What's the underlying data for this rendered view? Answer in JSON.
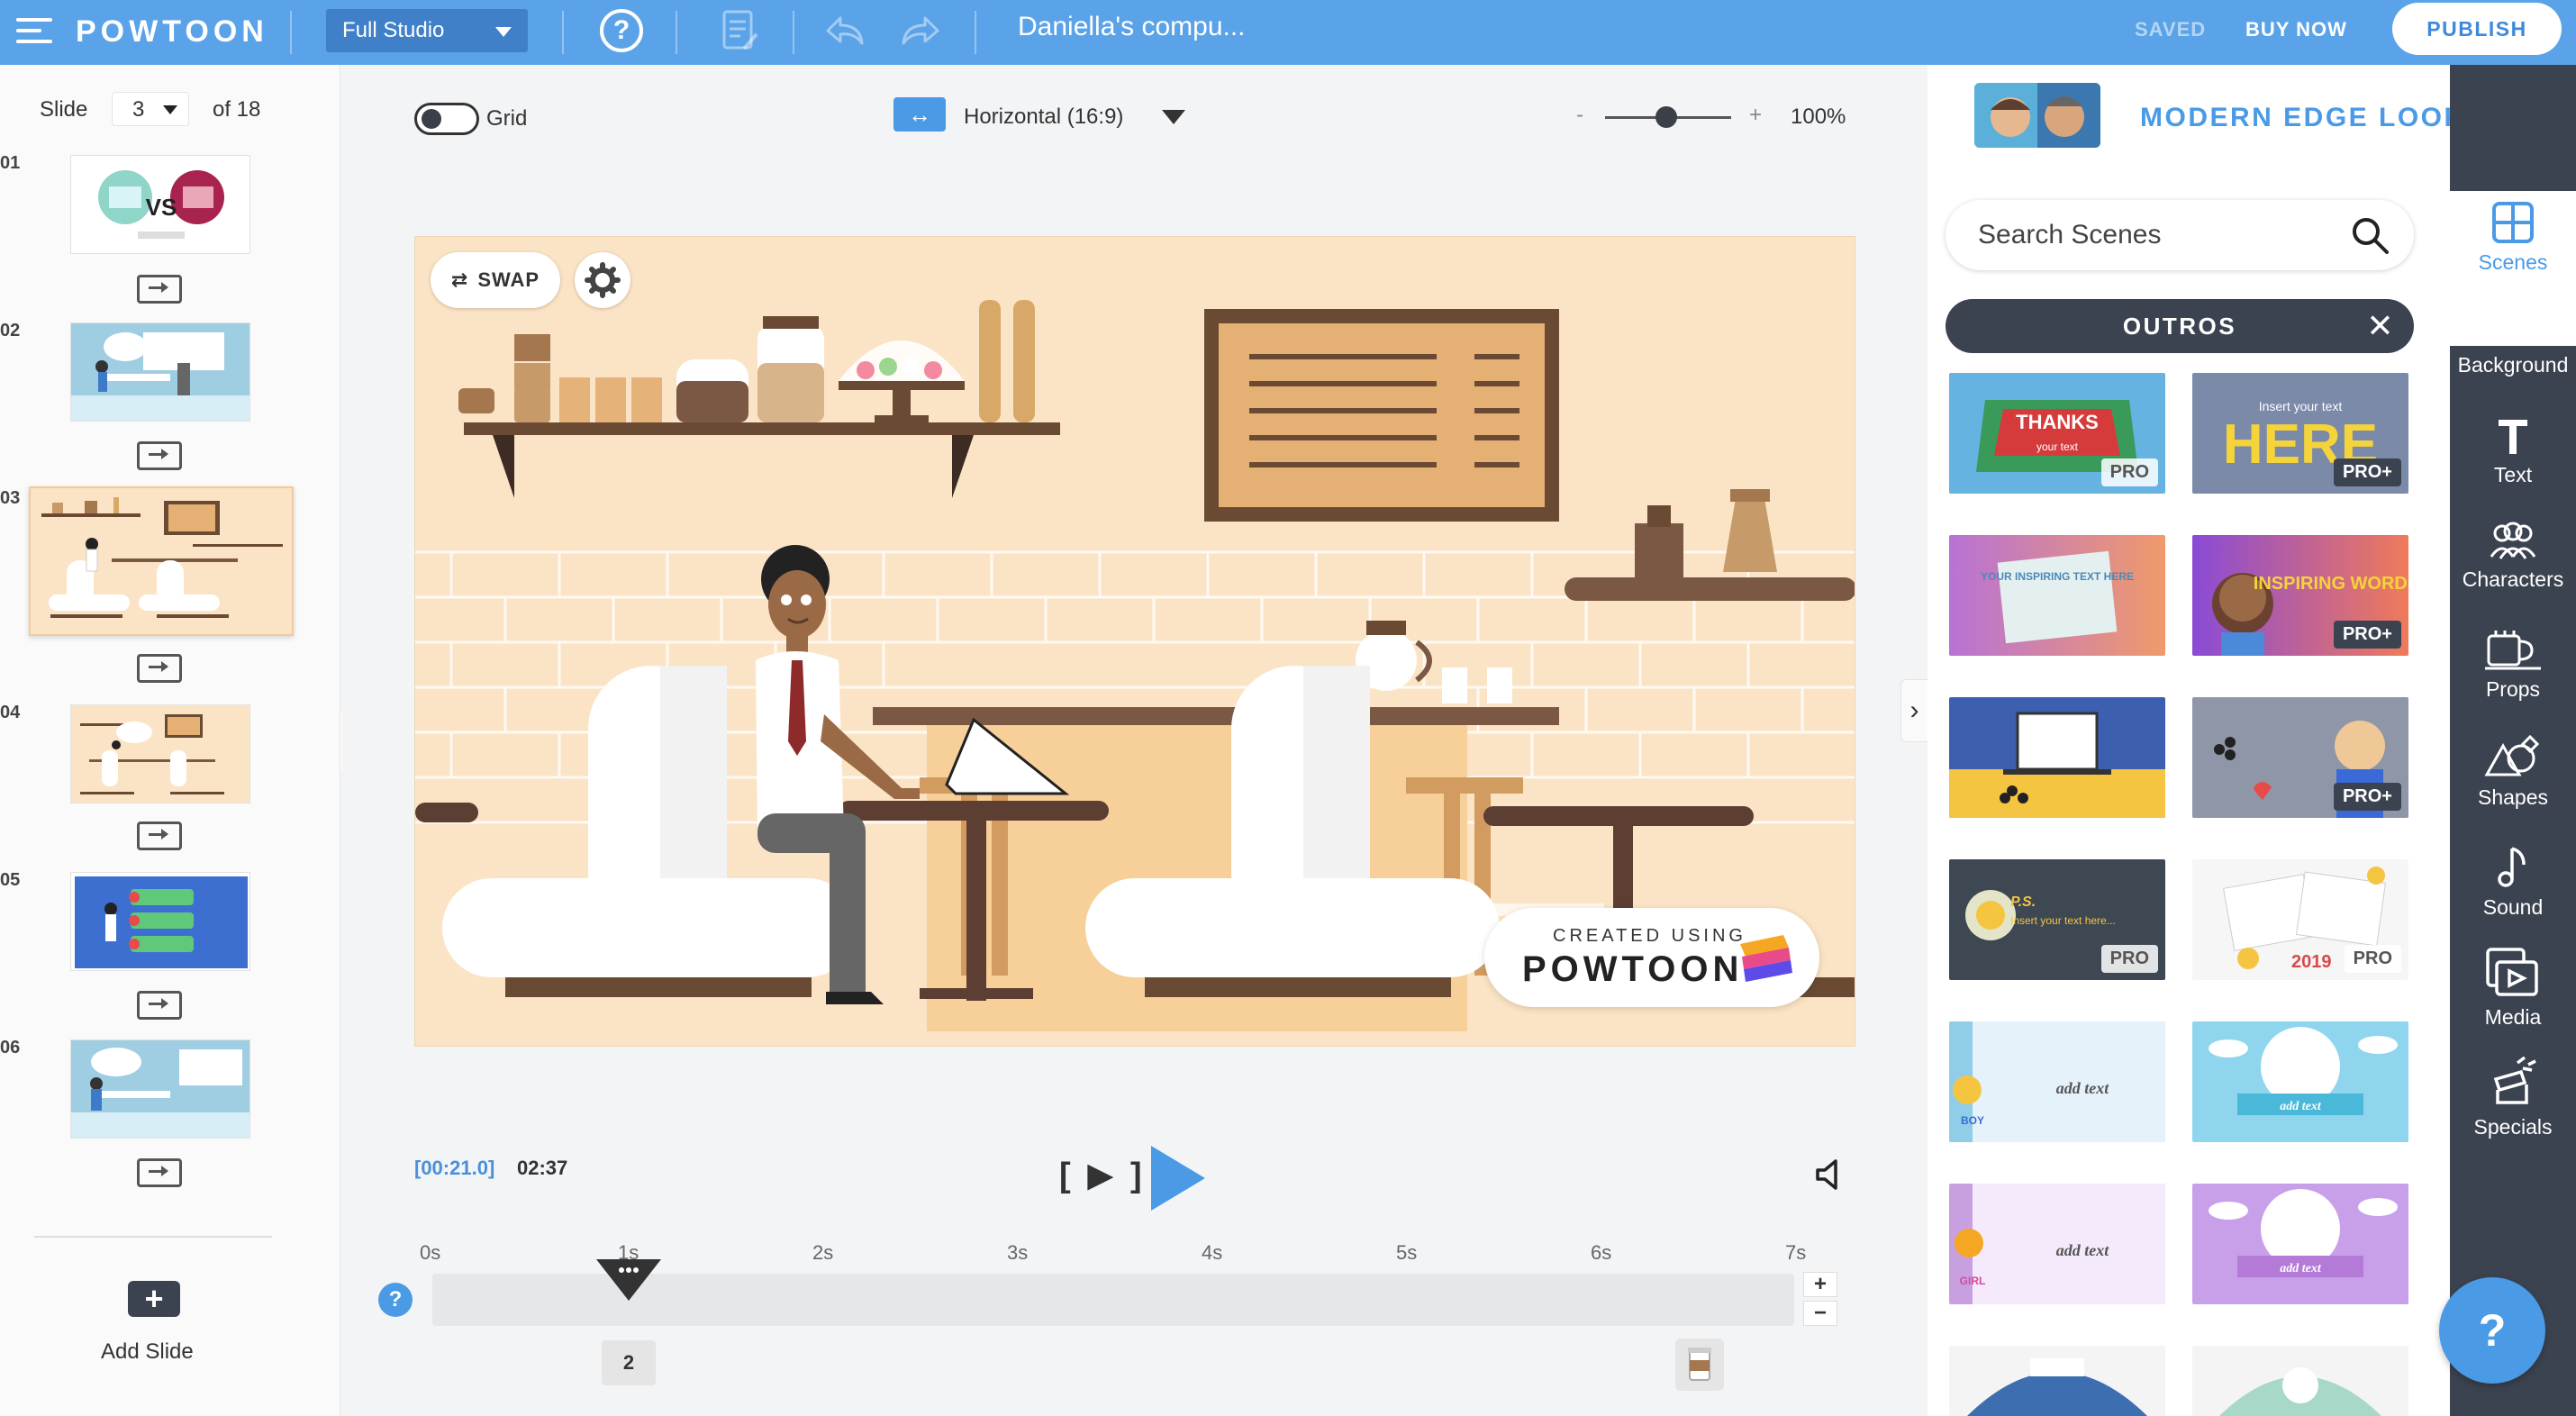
{
  "topbar": {
    "logo": "POWTOON",
    "studio_label": "Full Studio",
    "title": "Daniella's compu...",
    "saved": "SAVED",
    "buy_now": "BUY NOW",
    "publish": "PUBLISH",
    "help_icon": "question-circle-icon",
    "icons": [
      "notes-icon",
      "undo-icon",
      "redo-icon"
    ]
  },
  "slides": {
    "label": "Slide",
    "current": "3",
    "of": "of 18",
    "items": [
      {
        "num": "01"
      },
      {
        "num": "02"
      },
      {
        "num": "03"
      },
      {
        "num": "04"
      },
      {
        "num": "05"
      },
      {
        "num": "06"
      }
    ],
    "add_label": "Add Slide"
  },
  "canvas": {
    "grid_label": "Grid",
    "orientation": "Horizontal (16:9)",
    "zoom_minus": "-",
    "zoom_plus": "+",
    "zoom": "100%",
    "swap": "SWAP",
    "watermark_line1": "CREATED USING",
    "watermark_line2": "POWTOON"
  },
  "timeline": {
    "current": "[00:21.0]",
    "total": "02:37",
    "bracket_play": "[ ▶ ]",
    "ticks": [
      "0s",
      "1s",
      "2s",
      "3s",
      "4s",
      "5s",
      "6s",
      "7s"
    ],
    "marker": "2",
    "help": "?",
    "plus": "+",
    "minus": "−"
  },
  "library": {
    "look": "MODERN EDGE LOOK",
    "search_placeholder": "Search Scenes",
    "category": "OUTROS",
    "close": "✕",
    "scenes": [
      {
        "text": "THANKS",
        "badge": "PRO"
      },
      {
        "text": "HERE",
        "badge": "PRO+"
      },
      {
        "text": "YOUR INSPIRING TEXT HERE",
        "badge": ""
      },
      {
        "text": "INSPIRING WORDS",
        "badge": "PRO+"
      },
      {
        "text": "",
        "badge": ""
      },
      {
        "text": "",
        "badge": "PRO+"
      },
      {
        "text": "P.S.",
        "badge": "PRO"
      },
      {
        "text": "2019",
        "badge": "PRO"
      },
      {
        "text": "add text",
        "badge": ""
      },
      {
        "text": "add text",
        "badge": ""
      },
      {
        "text": "add text",
        "badge": ""
      },
      {
        "text": "add text",
        "badge": ""
      }
    ]
  },
  "sidebar": {
    "items": [
      {
        "label": "Scenes",
        "icon": "scenes-icon"
      },
      {
        "label": "Background",
        "icon": "background-icon"
      },
      {
        "label": "Text",
        "icon": "text-icon"
      },
      {
        "label": "Characters",
        "icon": "characters-icon"
      },
      {
        "label": "Props",
        "icon": "props-icon"
      },
      {
        "label": "Shapes",
        "icon": "shapes-icon"
      },
      {
        "label": "Sound",
        "icon": "sound-icon"
      },
      {
        "label": "Media",
        "icon": "media-icon"
      },
      {
        "label": "Specials",
        "icon": "specials-icon"
      }
    ]
  },
  "fab": "?",
  "colors": {
    "accent": "#4a9ae6",
    "topbar": "#5aa3e8",
    "dark": "#3c4350"
  }
}
